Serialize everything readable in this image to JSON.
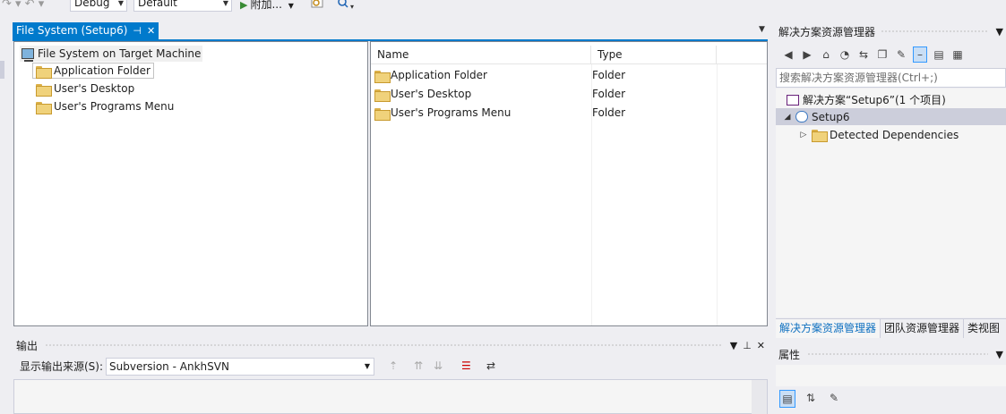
{
  "toolbar": {
    "config_value": "Debug",
    "platform_value": "Default",
    "run_label": "附加..."
  },
  "document": {
    "tab_title": "File System (Setup6)",
    "tab_pin": "⊣",
    "tab_close": "✕"
  },
  "tree": {
    "root_label": "File System on Target Machine",
    "items": [
      {
        "label": "Application Folder"
      },
      {
        "label": "User's Desktop"
      },
      {
        "label": "User's Programs Menu"
      }
    ]
  },
  "list": {
    "columns": [
      "Name",
      "Type"
    ],
    "rows": [
      {
        "name": "Application Folder",
        "type": "Folder"
      },
      {
        "name": "User's Desktop",
        "type": "Folder"
      },
      {
        "name": "User's Programs Menu",
        "type": "Folder"
      }
    ]
  },
  "output": {
    "title": "输出",
    "source_label": "显示输出来源(S):",
    "source_value": "Subversion - AnkhSVN"
  },
  "solution_explorer": {
    "title": "解决方案资源管理器",
    "search_placeholder": "搜索解决方案资源管理器(Ctrl+;)",
    "solution_label": "解决方案“Setup6”(1 个项目)",
    "project_label": "Setup6",
    "dependencies_label": "Detected Dependencies",
    "tabs": [
      {
        "label": "解决方案资源管理器"
      },
      {
        "label": "团队资源管理器"
      },
      {
        "label": "类视图"
      }
    ]
  },
  "properties": {
    "title": "属性"
  },
  "colors": {
    "accent": "#007acc",
    "folder": "#f0d27b"
  }
}
